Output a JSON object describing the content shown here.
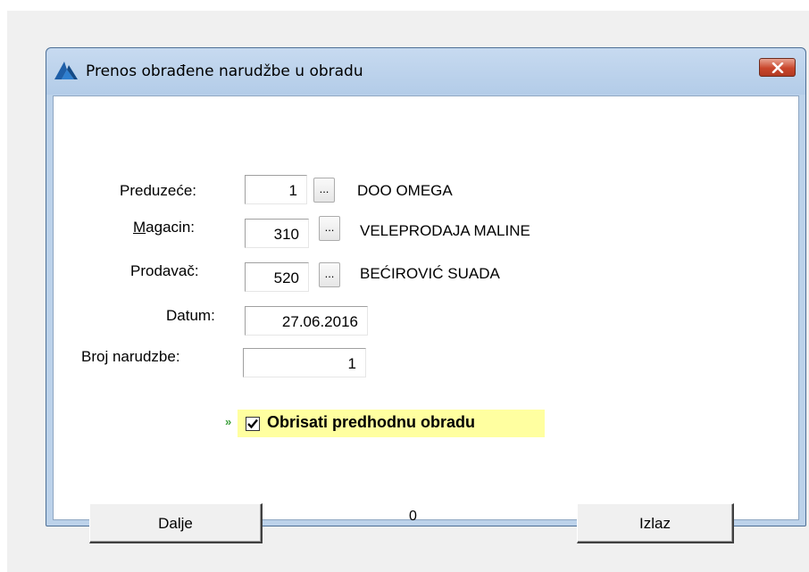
{
  "window": {
    "title": "Prenos obrađene narudžbe u obradu"
  },
  "form": {
    "preduzece": {
      "label": "Preduzeće:",
      "value": "1",
      "browse": "...",
      "desc": "DOO OMEGA"
    },
    "magacin": {
      "label_accel": "M",
      "label_rest": "agacin:",
      "value": "310",
      "browse": "...",
      "desc": "VELEPRODAJA MALINE"
    },
    "prodavac": {
      "label": "Prodavač:",
      "value": "520",
      "browse": "...",
      "desc": "BEĆIROVIĆ SUADA"
    },
    "datum": {
      "label": "Datum:",
      "value": "27.06.2016"
    },
    "broj": {
      "label": "Broj narudzbe:",
      "value": "1"
    }
  },
  "checkbox": {
    "marker": "»",
    "label": "Obrisati predhodnu obradu",
    "checked": true
  },
  "footer": {
    "next_label": "Dalje",
    "counter": "0",
    "exit_label": "Izlaz"
  },
  "colors": {
    "highlight": "#ffffa0",
    "close_button": "#c9462c",
    "titlebar": "#bcd2ea"
  },
  "icons": {
    "app": "app-logo-icon",
    "close": "close-icon",
    "check": "checkmark-icon"
  }
}
